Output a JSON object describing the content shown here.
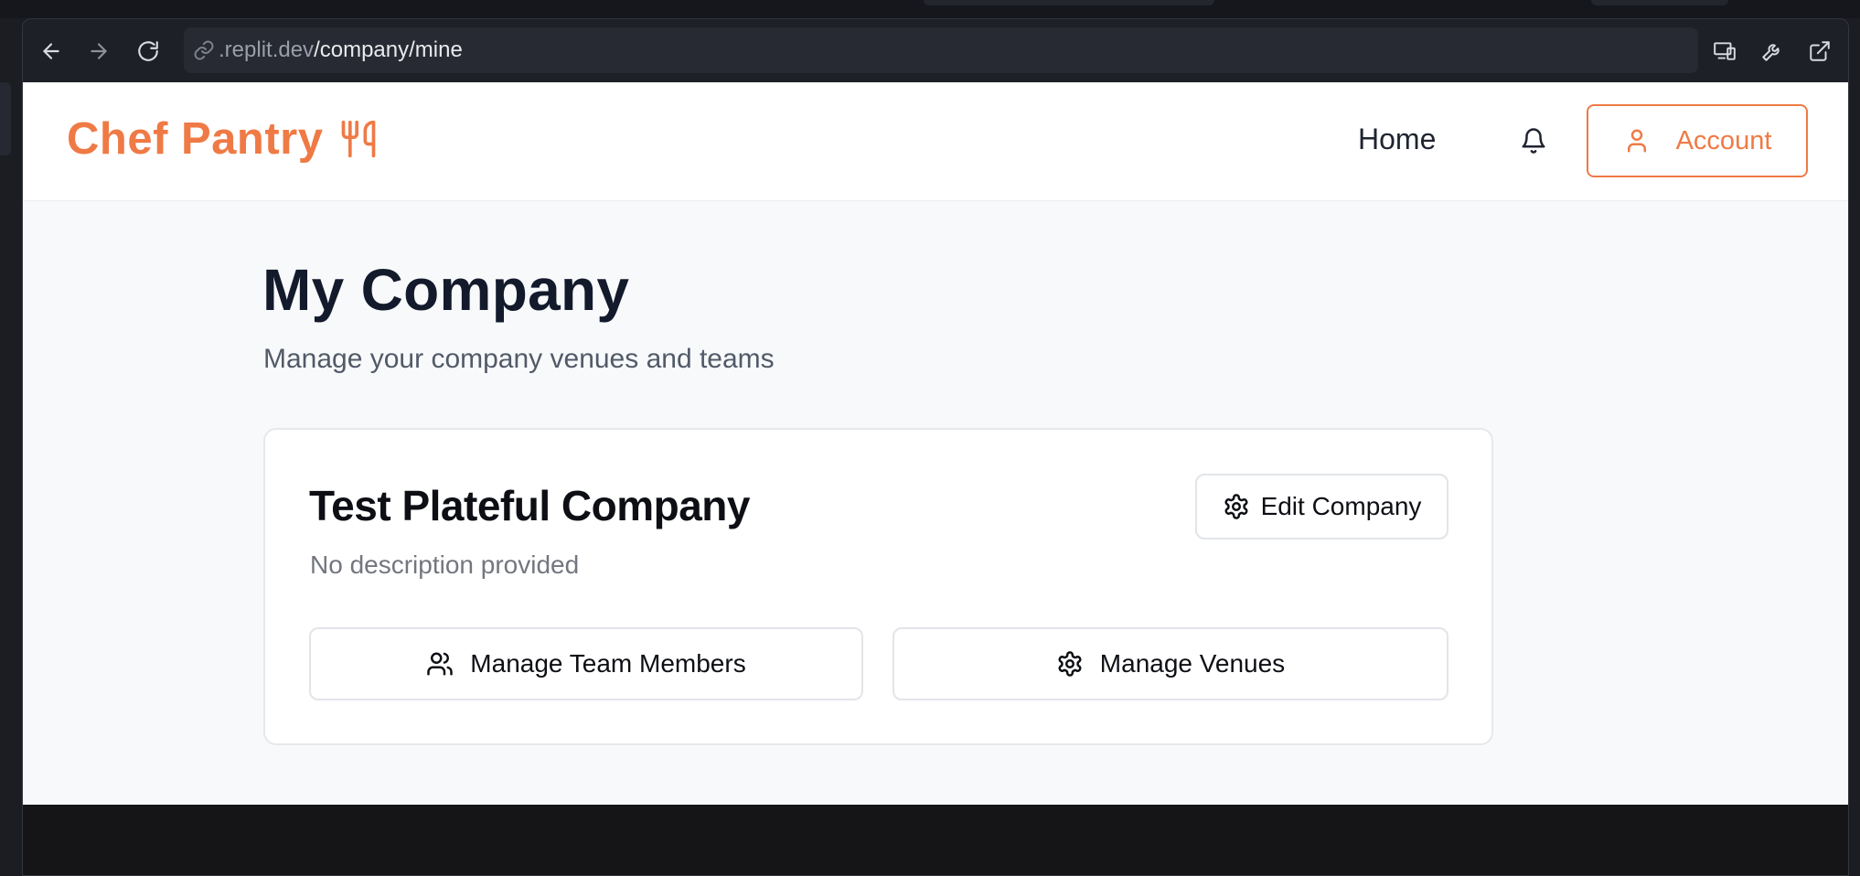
{
  "browser": {
    "url_domain": ".replit.dev",
    "url_path": "/company/mine"
  },
  "navbar": {
    "brand": "Chef Pantry",
    "home_label": "Home",
    "account_label": "Account"
  },
  "page": {
    "title": "My Company",
    "subtitle": "Manage your company venues and teams"
  },
  "company_card": {
    "name": "Test Plateful Company",
    "description": "No description provided",
    "edit_label": "Edit Company",
    "team_label": "Manage Team Members",
    "venues_label": "Manage Venues"
  },
  "colors": {
    "brand_accent": "#ef7a45",
    "page_bg": "#f8f9fb",
    "title_text": "#131a2c"
  },
  "icons": [
    "back-arrow-icon",
    "forward-arrow-icon",
    "reload-icon",
    "link-icon",
    "devices-icon",
    "wrench-icon",
    "external-link-icon",
    "utensils-icon",
    "bell-icon",
    "user-icon",
    "gear-icon",
    "users-icon"
  ]
}
